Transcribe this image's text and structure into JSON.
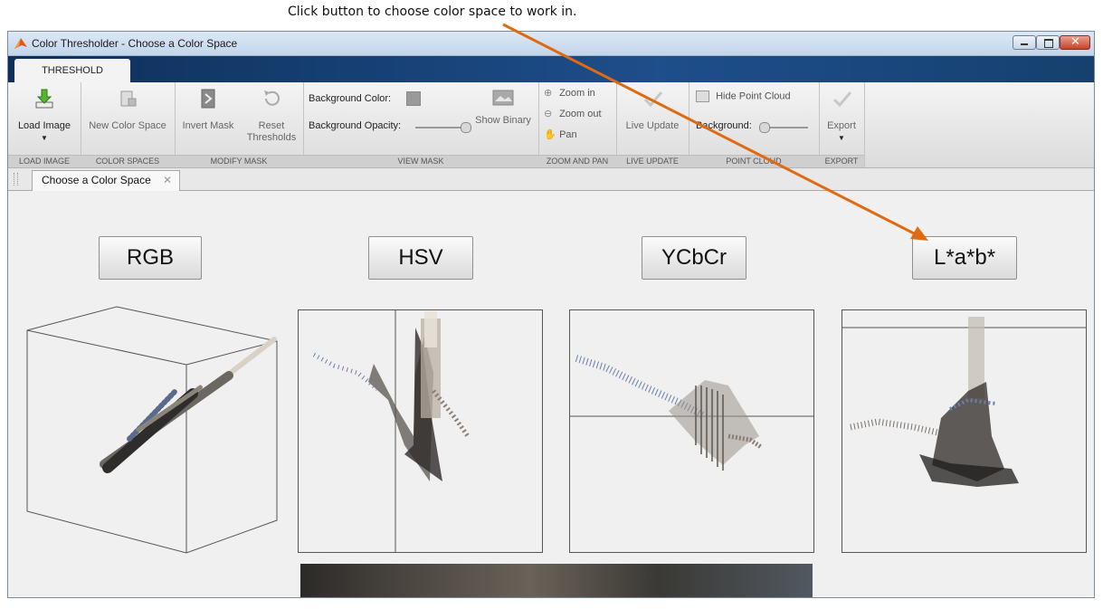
{
  "callout": {
    "text": "Click button to choose color space to work in."
  },
  "window": {
    "title": "Color Thresholder - Choose a Color Space",
    "tab": "THRESHOLD"
  },
  "ribbon": {
    "load_image": "Load Image",
    "new_color_space": "New Color Space",
    "invert_mask": "Invert Mask",
    "reset": "Reset",
    "thresholds": "Thresholds",
    "background_color": "Background Color:",
    "background_opacity": "Background Opacity:",
    "show_binary": "Show Binary",
    "zoom_in": "Zoom in",
    "zoom_out": "Zoom out",
    "pan": "Pan",
    "live_update": "Live Update",
    "hide_point_cloud": "Hide Point Cloud",
    "background": "Background:",
    "export": "Export",
    "sections": {
      "load_image": "LOAD IMAGE",
      "color_spaces": "COLOR SPACES",
      "modify_mask": "MODIFY MASK",
      "view_mask": "VIEW MASK",
      "zoom_and_pan": "ZOOM AND PAN",
      "live_update": "LIVE UPDATE",
      "point_cloud": "POINT CLOUD",
      "export": "EXPORT"
    }
  },
  "document_tab": {
    "label": "Choose a Color Space"
  },
  "color_spaces": [
    "RGB",
    "HSV",
    "YCbCr",
    "L*a*b*"
  ],
  "colors": {
    "ribbon_banner": "#1e4e8b",
    "arrow": "#e06a10",
    "close_button": "#c4442b",
    "content_bg": "#f0f0f0"
  },
  "icons": [
    "matlab-logo-icon",
    "load-image-icon",
    "new-color-space-icon",
    "invert-mask-icon",
    "reset-thresholds-icon",
    "background-color-swatch-icon",
    "show-binary-icon",
    "zoom-in-icon",
    "zoom-out-icon",
    "pan-icon",
    "live-update-icon",
    "hide-point-cloud-icon",
    "export-icon",
    "close-icon"
  ]
}
